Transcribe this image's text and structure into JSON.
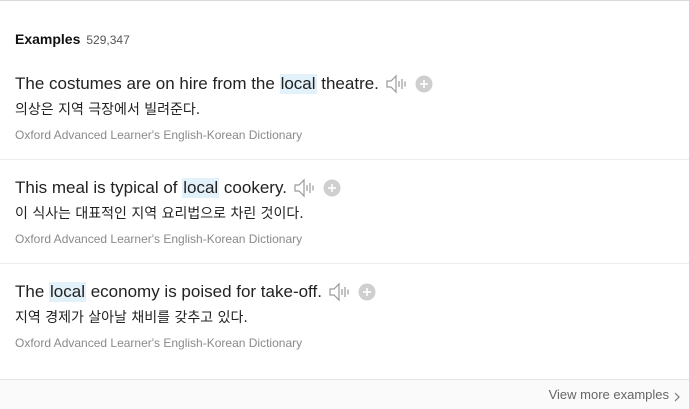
{
  "header": {
    "title": "Examples",
    "count": "529,347"
  },
  "examples": [
    {
      "before": "The costumes are on hire from the ",
      "keyword": "local",
      "after": " theatre.",
      "translation": "의상은 지역 극장에서 빌려준다.",
      "source": "Oxford Advanced Learner's English-Korean Dictionary"
    },
    {
      "before": "This meal is typical of ",
      "keyword": "local",
      "after": " cookery.",
      "translation": "이 식사는 대표적인 지역 요리법으로 차린 것이다.",
      "source": "Oxford Advanced Learner's English-Korean Dictionary"
    },
    {
      "before": "The ",
      "keyword": "local",
      "after": " economy is poised for take-off.",
      "translation": "지역 경제가 살아날 채비를 갖추고 있다.",
      "source": "Oxford Advanced Learner's English-Korean Dictionary"
    }
  ],
  "footer": {
    "more_label": "View more examples"
  },
  "icons": {
    "speaker": "speaker-icon",
    "add": "plus-circle-icon",
    "more": "chevron-right-icon"
  },
  "colors": {
    "highlight": "#e3f1fb",
    "icon_gray": "#c4c4c4",
    "source_gray": "#8a8a8a"
  }
}
